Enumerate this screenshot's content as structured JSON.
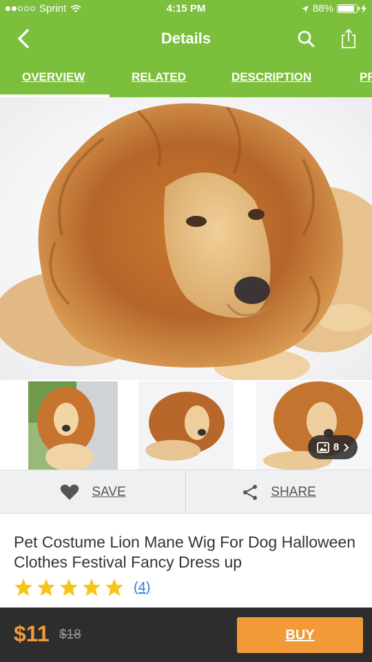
{
  "status_bar": {
    "carrier": "Sprint",
    "time": "4:15 PM",
    "battery_percent": "88%",
    "signal_bars_filled": 2,
    "signal_bars_total": 5
  },
  "header": {
    "title": "Details",
    "back_icon": "chevron-left-icon",
    "search_icon": "search-icon",
    "share_icon": "share-icon"
  },
  "tabs": [
    {
      "label": "OVERVIEW",
      "active": true
    },
    {
      "label": "RELATED",
      "active": false
    },
    {
      "label": "DESCRIPTION",
      "active": false
    },
    {
      "label": "PR",
      "active": false
    }
  ],
  "gallery": {
    "image_count": "8",
    "main_image": "dog wearing lion mane wig",
    "thumbnails": [
      "dog in lion mane standing outdoors",
      "dog in lion mane on white bed",
      "dog in lion mane lying down"
    ]
  },
  "actions": {
    "save_label": "SAVE",
    "share_label": "SHARE"
  },
  "product": {
    "title": "Pet Costume Lion Mane Wig For Dog Halloween Clothes Festival Fancy Dress up",
    "rating": 5,
    "review_count": "(4)"
  },
  "purchase": {
    "price": "$11",
    "original_price": "$18",
    "buy_label": "BUY"
  },
  "colors": {
    "brand_green": "#7cbf3c",
    "price_orange": "#f29a38",
    "star_yellow": "#f5c518",
    "link_blue": "#2a7bd4",
    "bottom_bar": "#2d2d2d"
  }
}
